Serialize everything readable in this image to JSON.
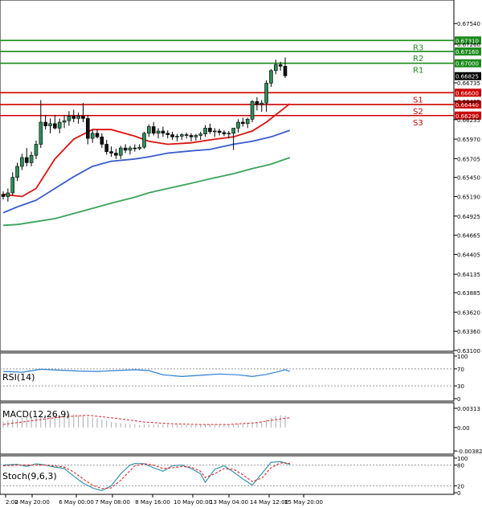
{
  "chart_data": [
    {
      "type": "candlestick",
      "panel": "price",
      "ylim": [
        0.631,
        0.6775
      ],
      "y_ticks": [
        "0.67540",
        "0.67260",
        "0.66735",
        "0.66485",
        "0.66235",
        "0.65970",
        "0.65705",
        "0.65450",
        "0.65190",
        "0.64925",
        "0.64665",
        "0.64405",
        "0.64135",
        "0.63885",
        "0.63620",
        "0.63360",
        "0.63100"
      ],
      "current_price_label": "0.66825",
      "current_price": 0.66825,
      "levels": [
        {
          "name": "R3",
          "value": 0.6731,
          "label": "0.67310",
          "color": "#1a8a1a"
        },
        {
          "name": "R2",
          "value": 0.6716,
          "label": "0.67160",
          "color": "#1a8a1a"
        },
        {
          "name": "R1",
          "value": 0.67,
          "label": "0.67000",
          "color": "#1a8a1a"
        },
        {
          "name": "S1",
          "value": 0.666,
          "label": "0.66600",
          "color": "#cc0000"
        },
        {
          "name": "S2",
          "value": 0.6644,
          "label": "0.66440",
          "color": "#cc0000"
        },
        {
          "name": "S3",
          "value": 0.6629,
          "label": "0.66290",
          "color": "#cc0000"
        }
      ],
      "candles": [
        [
          0.6522,
          0.6526,
          0.6515,
          0.6519
        ],
        [
          0.6519,
          0.653,
          0.6512,
          0.6524
        ],
        [
          0.6524,
          0.6552,
          0.6521,
          0.6545
        ],
        [
          0.6545,
          0.6565,
          0.654,
          0.656
        ],
        [
          0.656,
          0.6577,
          0.6555,
          0.6572
        ],
        [
          0.6572,
          0.6585,
          0.656,
          0.6565
        ],
        [
          0.6565,
          0.658,
          0.656,
          0.6575
        ],
        [
          0.6575,
          0.6595,
          0.657,
          0.659
        ],
        [
          0.659,
          0.665,
          0.6585,
          0.662
        ],
        [
          0.662,
          0.663,
          0.661,
          0.6615
        ],
        [
          0.6615,
          0.6625,
          0.6605,
          0.6618
        ],
        [
          0.6618,
          0.663,
          0.661,
          0.6612
        ],
        [
          0.6612,
          0.6625,
          0.6605,
          0.662
        ],
        [
          0.662,
          0.663,
          0.6612,
          0.6622
        ],
        [
          0.6622,
          0.6635,
          0.6615,
          0.6628
        ],
        [
          0.6628,
          0.6637,
          0.662,
          0.6625
        ],
        [
          0.6625,
          0.6633,
          0.6618,
          0.6628
        ],
        [
          0.6628,
          0.6646,
          0.662,
          0.6625
        ],
        [
          0.6625,
          0.663,
          0.659,
          0.6598
        ],
        [
          0.6598,
          0.661,
          0.6592,
          0.6605
        ],
        [
          0.6605,
          0.661,
          0.6598,
          0.66
        ],
        [
          0.66,
          0.6605,
          0.6585,
          0.659
        ],
        [
          0.659,
          0.6596,
          0.6576,
          0.658
        ],
        [
          0.658,
          0.6587,
          0.6573,
          0.6578
        ],
        [
          0.6578,
          0.6584,
          0.657,
          0.6575
        ],
        [
          0.6575,
          0.6588,
          0.657,
          0.6585
        ],
        [
          0.6585,
          0.659,
          0.6578,
          0.6582
        ],
        [
          0.6582,
          0.6588,
          0.6576,
          0.6585
        ],
        [
          0.6585,
          0.659,
          0.658,
          0.6584
        ],
        [
          0.6584,
          0.659,
          0.6582,
          0.6586
        ],
        [
          0.6586,
          0.6607,
          0.6584,
          0.6605
        ],
        [
          0.6605,
          0.6617,
          0.66,
          0.6614
        ],
        [
          0.6614,
          0.662,
          0.6602,
          0.6605
        ],
        [
          0.6605,
          0.6612,
          0.6598,
          0.6608
        ],
        [
          0.6608,
          0.6614,
          0.66,
          0.6605
        ],
        [
          0.6605,
          0.6609,
          0.6598,
          0.6603
        ],
        [
          0.6603,
          0.6607,
          0.6596,
          0.66
        ],
        [
          0.66,
          0.6604,
          0.6594,
          0.6601
        ],
        [
          0.6601,
          0.6605,
          0.6596,
          0.6603
        ],
        [
          0.6603,
          0.6606,
          0.6598,
          0.6602
        ],
        [
          0.6602,
          0.6605,
          0.6594,
          0.66
        ],
        [
          0.66,
          0.6604,
          0.6595,
          0.6602
        ],
        [
          0.6602,
          0.6607,
          0.6596,
          0.6604
        ],
        [
          0.6604,
          0.6616,
          0.66,
          0.6612
        ],
        [
          0.6612,
          0.6618,
          0.6604,
          0.6607
        ],
        [
          0.6607,
          0.6612,
          0.66,
          0.6608
        ],
        [
          0.6608,
          0.6611,
          0.6602,
          0.6606
        ],
        [
          0.6606,
          0.6609,
          0.6601,
          0.6604
        ],
        [
          0.6604,
          0.6608,
          0.6598,
          0.6605
        ],
        [
          0.6605,
          0.6612,
          0.6582,
          0.6612
        ],
        [
          0.6612,
          0.6624,
          0.6606,
          0.662
        ],
        [
          0.662,
          0.6626,
          0.6614,
          0.6618
        ],
        [
          0.6618,
          0.6626,
          0.6612,
          0.6624
        ],
        [
          0.6624,
          0.665,
          0.662,
          0.6648
        ],
        [
          0.6648,
          0.6654,
          0.6636,
          0.6644
        ],
        [
          0.6644,
          0.665,
          0.6634,
          0.6646
        ],
        [
          0.6646,
          0.6677,
          0.6634,
          0.6673
        ],
        [
          0.6673,
          0.6692,
          0.6668,
          0.669
        ],
        [
          0.669,
          0.6705,
          0.6685,
          0.6698
        ],
        [
          0.6698,
          0.6702,
          0.669,
          0.6696
        ],
        [
          0.6696,
          0.6708,
          0.668,
          0.6683
        ]
      ],
      "ma_lines": [
        {
          "color": "#dd1111",
          "points": [
            [
              0,
              0.6522
            ],
            [
              4,
              0.6519
            ],
            [
              7,
              0.653
            ],
            [
              11,
              0.657
            ],
            [
              15,
              0.6597
            ],
            [
              19,
              0.661
            ],
            [
              23,
              0.661
            ],
            [
              28,
              0.6601
            ],
            [
              31,
              0.6594
            ],
            [
              35,
              0.659
            ],
            [
              40,
              0.6592
            ],
            [
              44,
              0.6596
            ],
            [
              49,
              0.66
            ],
            [
              53,
              0.6608
            ],
            [
              56,
              0.662
            ],
            [
              59,
              0.6635
            ],
            [
              61,
              0.6645
            ]
          ]
        },
        {
          "color": "#3a5ccc",
          "points": [
            [
              0,
              0.6497
            ],
            [
              3,
              0.6505
            ],
            [
              7,
              0.6514
            ],
            [
              11,
              0.653
            ],
            [
              15,
              0.6546
            ],
            [
              19,
              0.656
            ],
            [
              23,
              0.6567
            ],
            [
              28,
              0.657
            ],
            [
              31,
              0.6573
            ],
            [
              35,
              0.6578
            ],
            [
              40,
              0.6581
            ],
            [
              44,
              0.6583
            ],
            [
              49,
              0.659
            ],
            [
              53,
              0.6594
            ],
            [
              57,
              0.66
            ],
            [
              61,
              0.6609
            ]
          ]
        },
        {
          "color": "#3aa35a",
          "points": [
            [
              0,
              0.648
            ],
            [
              3,
              0.6481
            ],
            [
              7,
              0.6485
            ],
            [
              11,
              0.6489
            ],
            [
              15,
              0.6496
            ],
            [
              19,
              0.6503
            ],
            [
              23,
              0.651
            ],
            [
              28,
              0.6518
            ],
            [
              31,
              0.6524
            ],
            [
              35,
              0.653
            ],
            [
              40,
              0.6537
            ],
            [
              44,
              0.6543
            ],
            [
              49,
              0.655
            ],
            [
              53,
              0.6557
            ],
            [
              57,
              0.6563
            ],
            [
              61,
              0.6572
            ]
          ]
        }
      ],
      "x_labels": [
        "2:00",
        "2 May 20:00",
        "6 May 00:00",
        "7 May 08:00",
        "8 May 16:00",
        "10 May 00:00",
        "13 May 04:00",
        "14 May 12:00",
        "15 May 20:00"
      ]
    },
    {
      "type": "line",
      "panel": "rsi",
      "title": "RSI(14)",
      "ylim": [
        0,
        100
      ],
      "y_ticks": [
        "100",
        "70",
        "30",
        "0"
      ],
      "levels": [
        70,
        30
      ],
      "x": [
        0,
        4,
        8,
        12,
        16,
        20,
        24,
        28,
        31,
        34,
        38,
        42,
        46,
        50,
        53,
        56,
        58,
        60,
        61
      ],
      "y": [
        64,
        62,
        69,
        67,
        65,
        64,
        66,
        68,
        66,
        56,
        52,
        55,
        58,
        56,
        52,
        57,
        62,
        68,
        64
      ]
    },
    {
      "type": "bar",
      "panel": "macd",
      "title": "MACD(12,26,9)",
      "ylim": [
        -0.00382,
        0.00313
      ],
      "y_ticks": [
        "0.00313",
        "0.00",
        "-0.003827"
      ],
      "histogram": [
        0.001,
        0.0011,
        0.0013,
        0.0014,
        0.0016,
        0.0017,
        0.0018,
        0.0019,
        0.002,
        0.002,
        0.0021,
        0.0021,
        0.0021,
        0.0021,
        0.0021,
        0.0021,
        0.002,
        0.002,
        0.0018,
        0.0016,
        0.0015,
        0.0013,
        0.0011,
        0.0009,
        0.0008,
        0.0007,
        0.0006,
        0.0005,
        0.0005,
        0.0004,
        0.0005,
        0.0005,
        0.0005,
        0.0005,
        0.0005,
        0.0005,
        0.0004,
        0.0004,
        0.0004,
        0.0004,
        0.0004,
        0.0004,
        0.0004,
        0.0005,
        0.0005,
        0.0005,
        0.0004,
        0.0004,
        0.0004,
        0.0005,
        0.0006,
        0.0006,
        0.0007,
        0.0008,
        0.0009,
        0.001,
        0.0013,
        0.0016,
        0.0019,
        0.002,
        0.0019
      ],
      "signal": {
        "x": [
          0,
          6,
          12,
          18,
          24,
          30,
          36,
          42,
          48,
          54,
          58,
          61
        ],
        "y": [
          0.0005,
          0.0011,
          0.0017,
          0.002,
          0.0015,
          0.0009,
          0.0006,
          0.0005,
          0.0005,
          0.0008,
          0.0013,
          0.0016
        ]
      }
    },
    {
      "type": "line",
      "panel": "stoch",
      "title": "Stoch(9,6,3)",
      "ylim": [
        0,
        100
      ],
      "y_ticks": [
        "100",
        "80",
        "20",
        "0"
      ],
      "levels": [
        80,
        20
      ],
      "series": [
        {
          "color": "#2a8ca8",
          "x": [
            0,
            3,
            5,
            7,
            9,
            11,
            13,
            15,
            17,
            19,
            21,
            23,
            25,
            27,
            28,
            30,
            32,
            34,
            36,
            38,
            40,
            42,
            43,
            45,
            47,
            49,
            51,
            53,
            55,
            57,
            59,
            61
          ],
          "y": [
            80,
            82,
            76,
            84,
            80,
            74,
            70,
            48,
            28,
            14,
            6,
            20,
            55,
            80,
            85,
            84,
            72,
            62,
            78,
            80,
            70,
            55,
            30,
            68,
            78,
            60,
            40,
            22,
            55,
            88,
            90,
            82
          ]
        },
        {
          "color": "#dd2222",
          "dashed": true,
          "x": [
            0,
            3,
            5,
            7,
            9,
            11,
            13,
            15,
            17,
            19,
            21,
            23,
            25,
            27,
            28,
            30,
            32,
            34,
            36,
            38,
            40,
            42,
            43,
            45,
            47,
            49,
            51,
            53,
            55,
            57,
            59,
            61
          ],
          "y": [
            78,
            80,
            80,
            80,
            80,
            78,
            74,
            60,
            40,
            22,
            12,
            14,
            36,
            64,
            78,
            84,
            80,
            70,
            72,
            76,
            74,
            62,
            44,
            55,
            70,
            68,
            52,
            32,
            42,
            72,
            86,
            85
          ]
        }
      ]
    }
  ]
}
